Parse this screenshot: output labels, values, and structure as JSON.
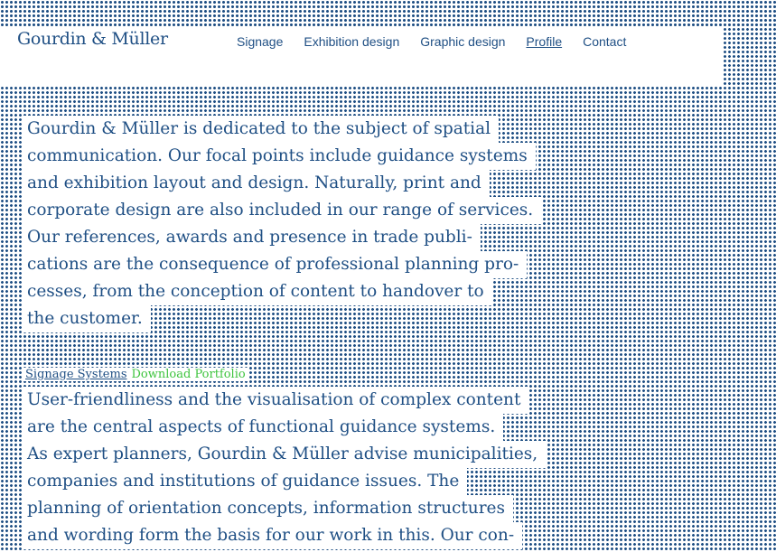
{
  "header": {
    "logo": "Gourdin & Müller",
    "nav": [
      {
        "label": "Signage",
        "active": false
      },
      {
        "label": "Exhibition design",
        "active": false
      },
      {
        "label": "Graphic design",
        "active": false
      },
      {
        "label": "Profile",
        "active": true
      },
      {
        "label": "Contact",
        "active": false
      }
    ]
  },
  "intro": {
    "lines": [
      "Gourdin & Müller is dedicated to the subject of spatial",
      "communication. Our focal points include guidance systems",
      "and exhibition layout and design. Naturally, print and",
      "corporate design are also included in our range of services.",
      "Our references, awards and presence in trade publi-",
      "cations are the consequence of professional planning pro-",
      "cesses, from the conception of content to handover to",
      "the customer."
    ]
  },
  "signage": {
    "title_link": "Signage Systems",
    "download_link": "Download Portfolio",
    "lines": [
      "User-friendliness and the visualisation of complex content",
      "are the central aspects of functional guidance systems.",
      "As expert planners, Gourdin & Müller advise municipalities,",
      "companies and institutions of guidance issues. The",
      "planning of orientation concepts, information structures",
      "and wording form the basis for our work in this. Our con-"
    ]
  },
  "colors": {
    "brand_blue": "#1f4f84",
    "link_green": "#3ec43e",
    "background": "#ffffff"
  }
}
